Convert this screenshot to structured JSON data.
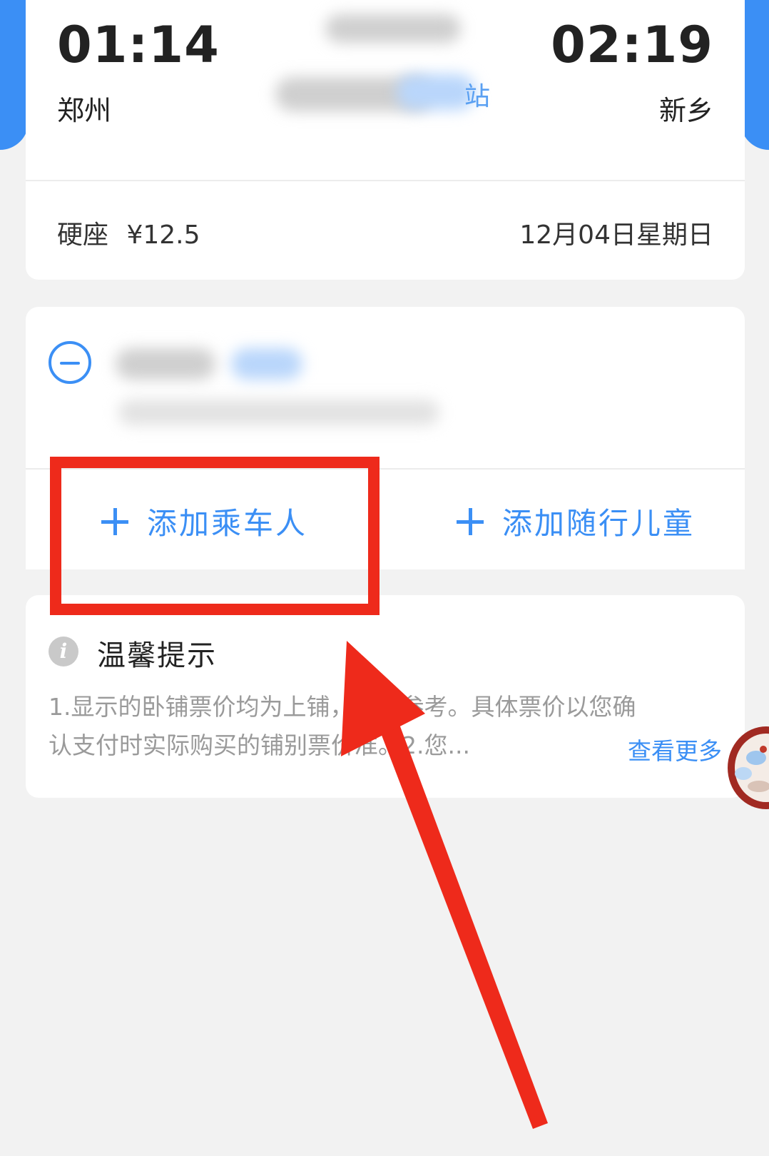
{
  "trip": {
    "depart_time": "01:14",
    "depart_city": "郑州",
    "arrive_time": "02:19",
    "arrive_city": "新乡",
    "station_suffix": "站",
    "seat_label": "硬座",
    "price": "¥12.5",
    "date": "12月04日星期日"
  },
  "passenger": {
    "add_passenger_label": "添加乘车人",
    "add_child_label": "添加随行儿童"
  },
  "tips": {
    "title": "温馨提示",
    "line1": "1.显示的卧铺票价均为上铺",
    "line1b": "，供您参考。具体票价以您确",
    "line2": "认支付时实际购买的铺别票价",
    "line2b": "准。2.您...",
    "see_more": "查看更多"
  },
  "colors": {
    "accent": "#3b8ff5",
    "annotation": "#ee2a1b",
    "background": "#f2f2f2"
  }
}
